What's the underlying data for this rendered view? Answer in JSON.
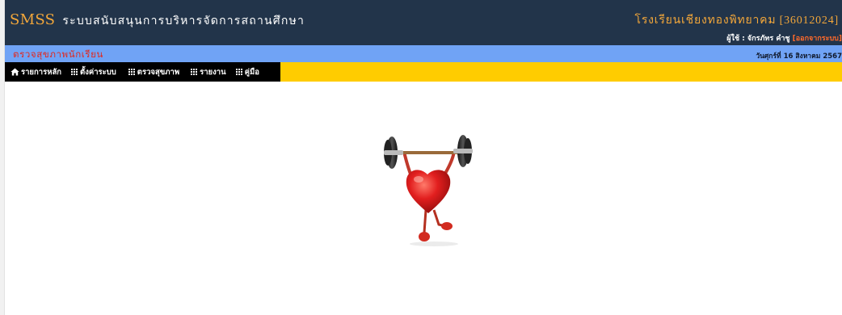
{
  "header": {
    "logo": "SMSS",
    "system_name": "ระบบสนับสนุนการบริหารจัดการสถานศึกษา",
    "school": "โรงเรียนเชียงทองพิทยาคม [36012024]",
    "user_label": "ผู้ใช้ : จักรภัทร คำชู",
    "logout_label": "[ออกจากระบบ]"
  },
  "titlebar": {
    "page_title": "ตรวจสุขภาพนักเรียน",
    "date": "วันศุกร์ที่ 16 สิงหาคม 2567"
  },
  "menu": {
    "items": [
      {
        "label": "รายการหลัก",
        "icon": "home-icon"
      },
      {
        "label": "ตั้งค่าระบบ",
        "icon": "grid-icon"
      },
      {
        "label": "ตรวจสุขภาพ",
        "icon": "grid-icon"
      },
      {
        "label": "รายงาน",
        "icon": "grid-icon"
      },
      {
        "label": "คู่มือ",
        "icon": "grid-icon"
      }
    ]
  },
  "colors": {
    "header_bg": "#22344a",
    "accent_orange": "#f3a73a",
    "titlebar_bg": "#70a3f5",
    "title_red": "#e0291f",
    "menubar_yellow": "#ffcc00",
    "menu_black": "#000000"
  },
  "illustration": {
    "icon": "heart-lifting-barbell-icon"
  }
}
